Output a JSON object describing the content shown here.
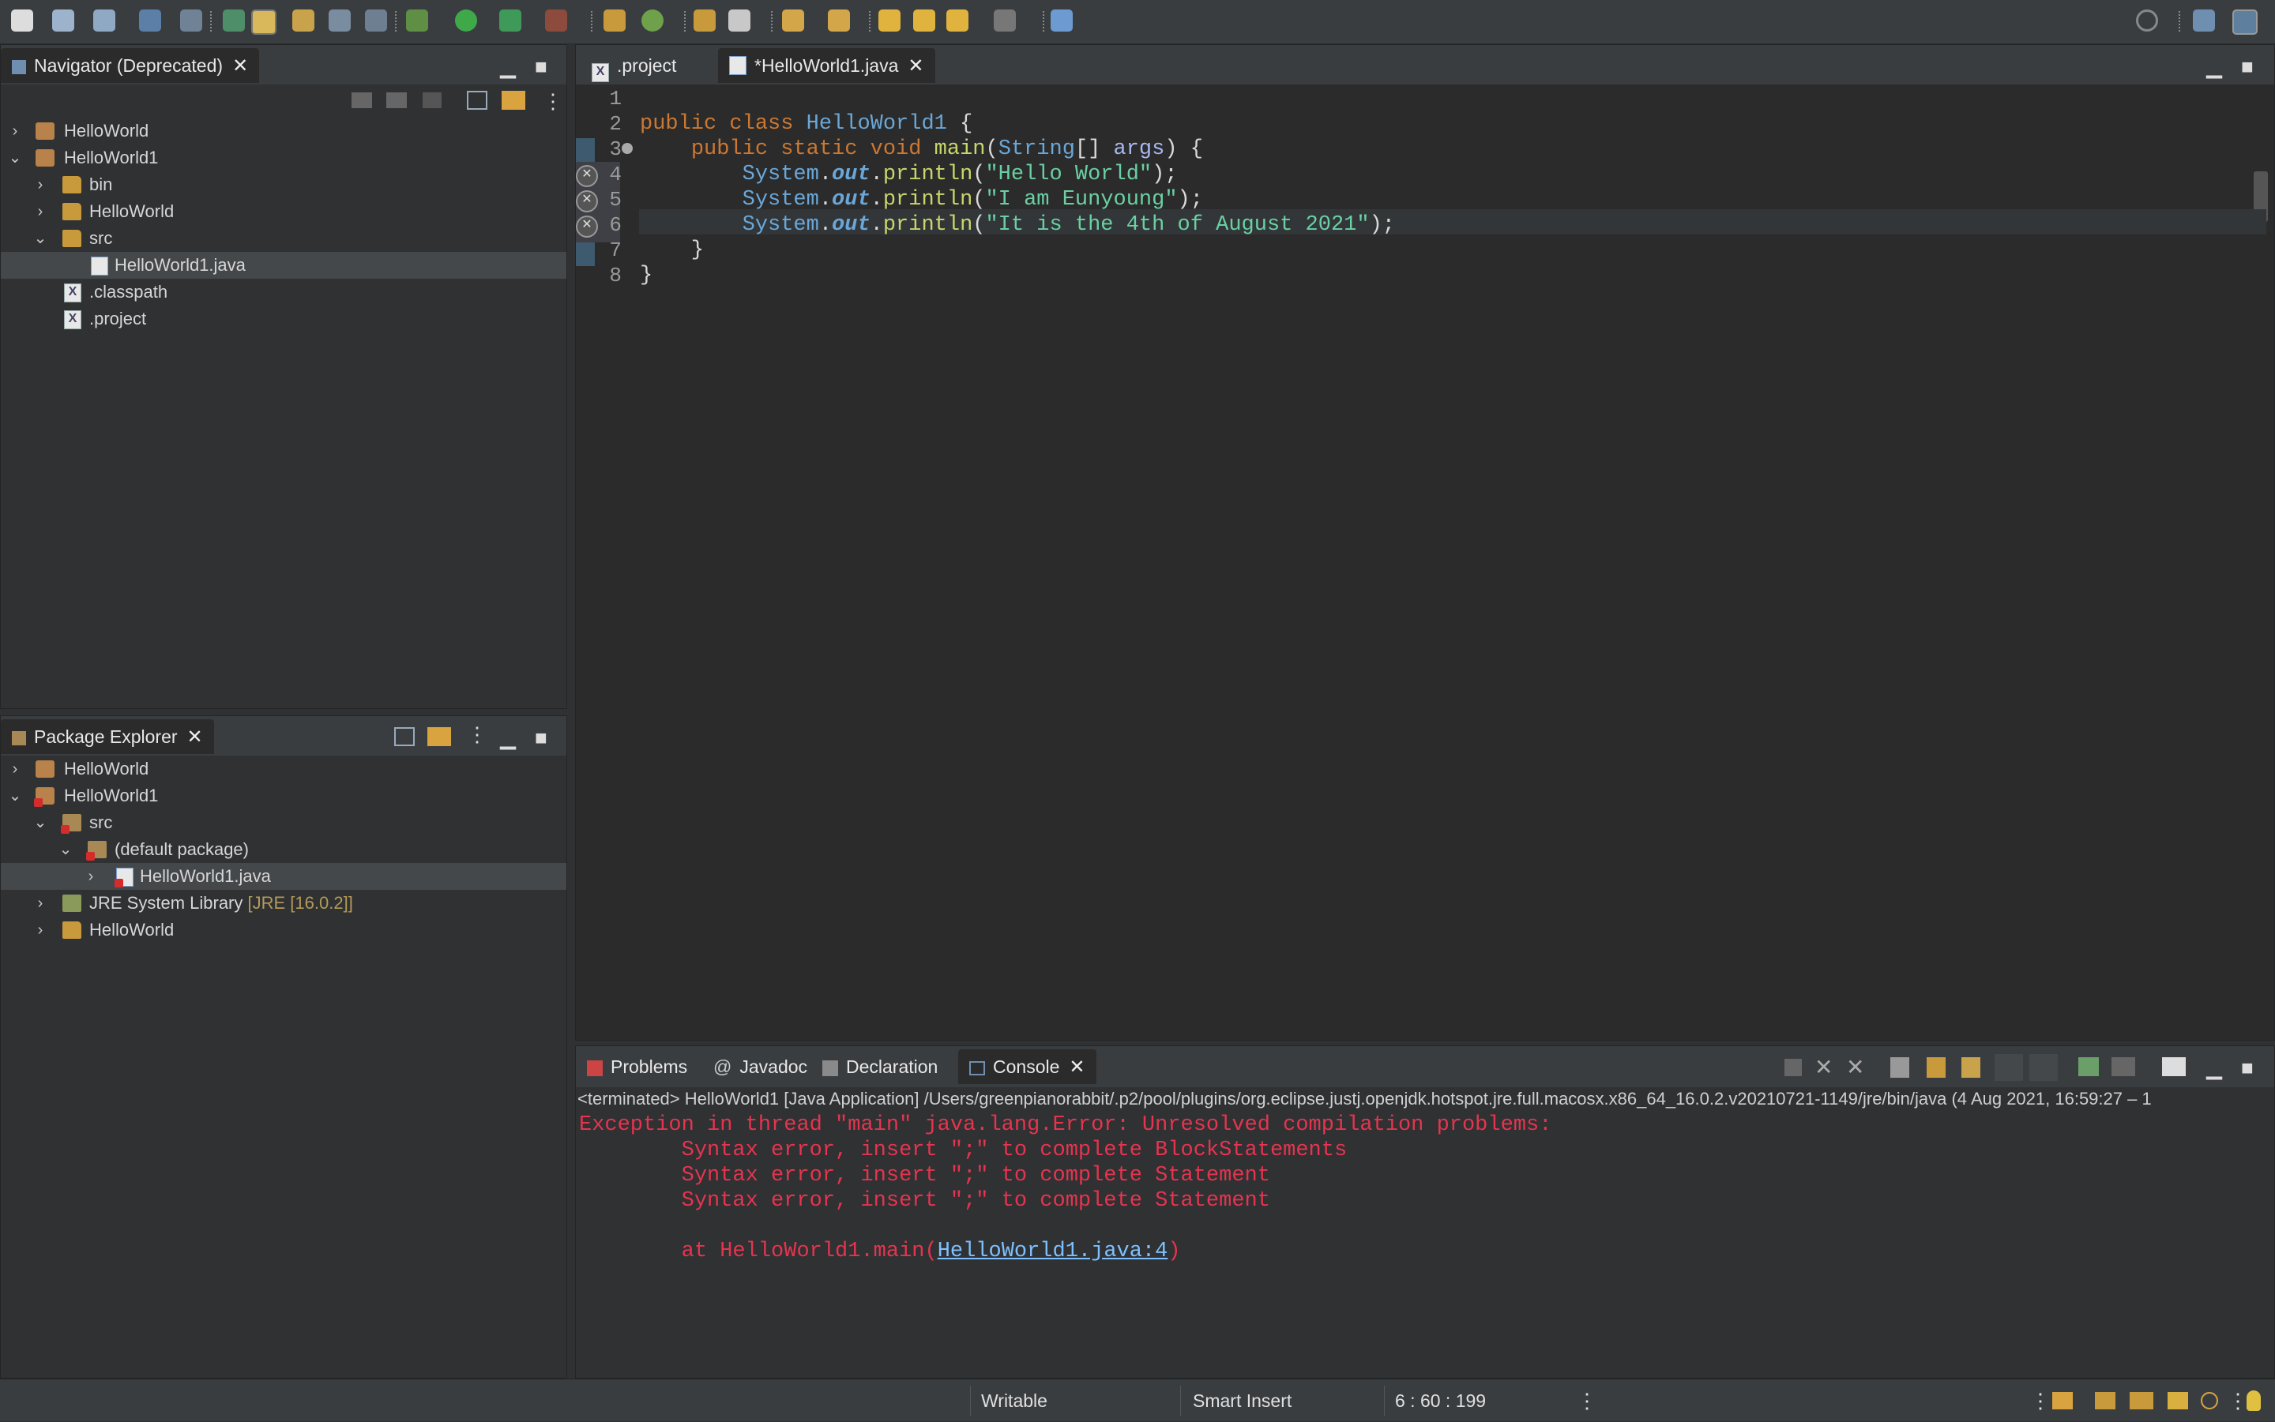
{
  "navigator": {
    "title": "Navigator (Deprecated)",
    "items": [
      {
        "label": "HelloWorld"
      },
      {
        "label": "HelloWorld1"
      },
      {
        "label": "bin"
      },
      {
        "label": "HelloWorld"
      },
      {
        "label": "src"
      },
      {
        "label": "HelloWorld1.java"
      },
      {
        "label": ".classpath"
      },
      {
        "label": ".project"
      }
    ]
  },
  "package_explorer": {
    "title": "Package Explorer",
    "items": [
      {
        "label": "HelloWorld"
      },
      {
        "label": "HelloWorld1"
      },
      {
        "label": "src"
      },
      {
        "label": "(default package)"
      },
      {
        "label": "HelloWorld1.java"
      },
      {
        "label": "JRE System Library",
        "decoration": "[JRE [16.0.2]]"
      },
      {
        "label": "HelloWorld"
      }
    ]
  },
  "editor": {
    "tabs": [
      {
        "label": ".project"
      },
      {
        "label": "*HelloWorld1.java"
      }
    ],
    "line_numbers": [
      "1",
      "2",
      "3",
      "4",
      "5",
      "6",
      "7",
      "8"
    ],
    "code": {
      "l2_kw": "public class ",
      "l2_cls": "HelloWorld1",
      "l2_rest": " {",
      "l3_indent": "    ",
      "l3_kw": "public static void ",
      "l3_fn": "main",
      "l3_open": "(",
      "l3_type": "String",
      "l3_mid": "[] ",
      "l3_param": "args",
      "l3_close": ") {",
      "indent2": "        ",
      "sys": "System",
      "dot": ".",
      "out": "out",
      "println": "println",
      "open": "(",
      "l4_str": "\"Hello World\"",
      "l5_str": "\"I am Eunyoung\"",
      "l6_str": "\"It is the 4th of August 2021\"",
      "close": ");",
      "l7": "    }",
      "l8": "}"
    },
    "error_marker": "ⓧ"
  },
  "console_view": {
    "tabs": [
      {
        "label": "Problems"
      },
      {
        "label": "Javadoc"
      },
      {
        "label": "Declaration"
      },
      {
        "label": "Console"
      }
    ],
    "header": "<terminated> HelloWorld1 [Java Application] /Users/greenpianorabbit/.p2/pool/plugins/org.eclipse.justj.openjdk.hotspot.jre.full.macosx.x86_64_16.0.2.v20210721-1149/jre/bin/java  (4 Aug 2021, 16:59:27 – 1",
    "lines": [
      "Exception in thread \"main\" java.lang.Error: Unresolved compilation problems: ",
      "        Syntax error, insert \";\" to complete BlockStatements",
      "        Syntax error, insert \";\" to complete Statement",
      "        Syntax error, insert \";\" to complete Statement"
    ],
    "trace_prefix": "        at HelloWorld1.main(",
    "trace_link": "HelloWorld1.java:4",
    "trace_suffix": ")"
  },
  "status": {
    "writable": "Writable",
    "insert_mode": "Smart Insert",
    "position": "6 : 60 : 199"
  },
  "colors": {
    "accent": "#6aa7d8",
    "error": "#e6344f",
    "background": "#2f3133"
  }
}
